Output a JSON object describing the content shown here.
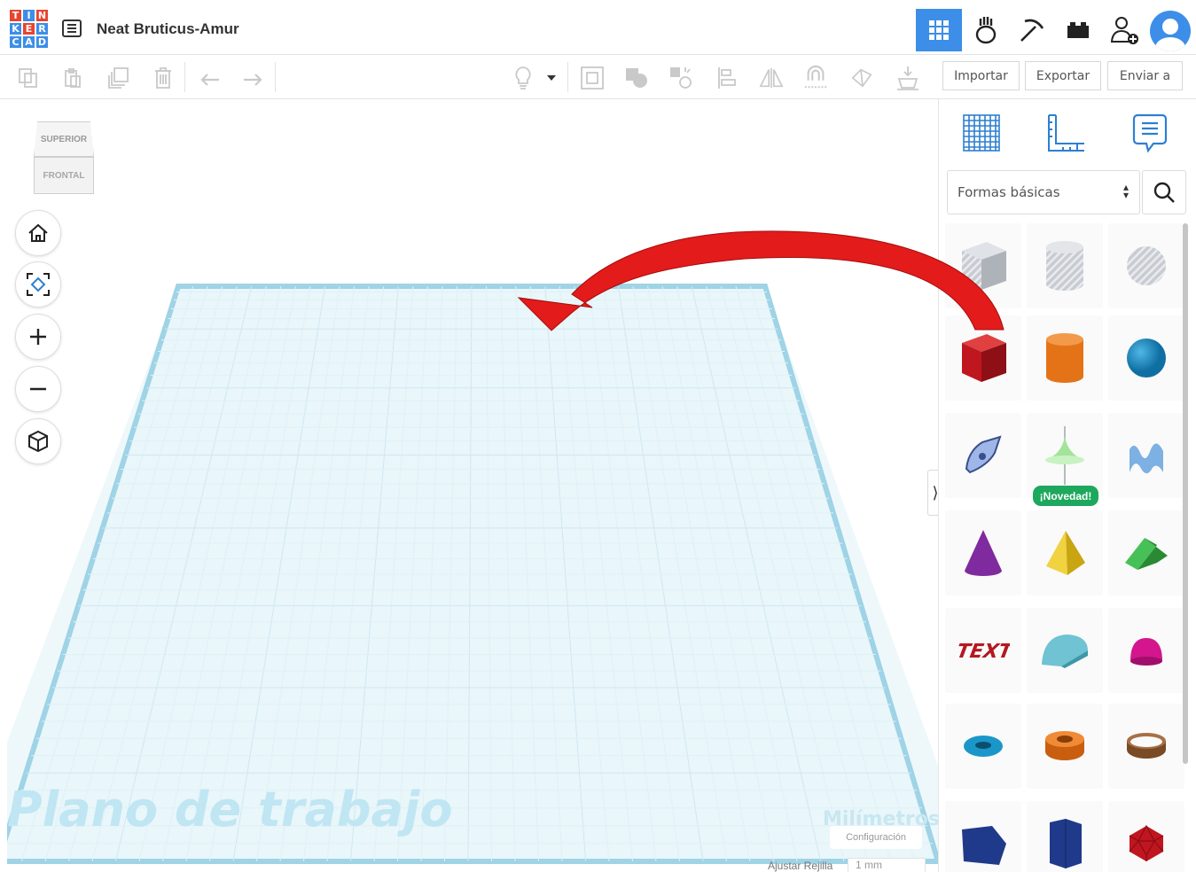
{
  "app": {
    "logo_letters": [
      "T",
      "I",
      "N",
      "K",
      "E",
      "R",
      "C",
      "A",
      "D"
    ],
    "logo_colors": [
      "#e8442e",
      "#3c8ee8",
      "#e8442e",
      "#3c8ee8",
      "#e8442e",
      "#3c8ee8",
      "#3c8ee8",
      "#3c8ee8",
      "#3c8ee8"
    ],
    "design_title": "Neat Bruticus-Amur",
    "accent_color": "#3c8ee8"
  },
  "top_nav": {
    "items": [
      {
        "icon": "grid-view-icon",
        "active": true
      },
      {
        "icon": "blocks-bot-icon",
        "active": false
      },
      {
        "icon": "pickaxe-icon",
        "active": false
      },
      {
        "icon": "brick-icon",
        "active": false
      },
      {
        "icon": "add-user-icon",
        "active": false
      },
      {
        "icon": "avatar-icon",
        "active": false
      }
    ]
  },
  "toolbar": {
    "tools": [
      "copy-icon",
      "paste-icon",
      "duplicate-icon",
      "delete-icon",
      "undo-icon",
      "redo-icon"
    ],
    "view_tools": [
      "light-bulb-icon",
      "dropdown-icon",
      "workplane-icon",
      "group-icon",
      "ungroup-icon",
      "align-icon",
      "mirror-icon",
      "magnet-icon",
      "solid-icon",
      "cruise-icon"
    ],
    "import_label": "Importar",
    "export_label": "Exportar",
    "send_label": "Enviar a"
  },
  "viewcube": {
    "top_label": "SUPERIOR",
    "front_label": "FRONTAL"
  },
  "nav_controls": [
    "home-icon",
    "fit-view-icon",
    "zoom-in-icon",
    "zoom-out-icon",
    "perspective-icon"
  ],
  "workplane": {
    "label": "Plano de trabajo",
    "units": "Milímetros",
    "settings_label": "Configuración",
    "snap_label": "Ajustar Rejilla",
    "snap_value": "1 mm"
  },
  "shapes_panel": {
    "category": "Formas básicas",
    "new_badge": "¡Novedad!",
    "shapes": [
      {
        "name": "hole-box",
        "color": "#b9bec6"
      },
      {
        "name": "hole-cylinder",
        "color": "#b9bec6"
      },
      {
        "name": "hole-sphere",
        "color": "#b9bec6"
      },
      {
        "name": "box",
        "color": "#c0161f"
      },
      {
        "name": "cylinder",
        "color": "#e47318"
      },
      {
        "name": "sphere",
        "color": "#1a8fc9"
      },
      {
        "name": "scribble",
        "color": "#7d9ad8"
      },
      {
        "name": "spinner",
        "color": "#a4e39a"
      },
      {
        "name": "wave",
        "color": "#7db0e3"
      },
      {
        "name": "cone",
        "color": "#7f2a9e"
      },
      {
        "name": "pyramid",
        "color": "#e8c71b"
      },
      {
        "name": "roof",
        "color": "#31a23c"
      },
      {
        "name": "text",
        "color": "#b41820"
      },
      {
        "name": "half-cylinder",
        "color": "#5fb7c7"
      },
      {
        "name": "paraboloid",
        "color": "#d3168d"
      },
      {
        "name": "torus",
        "color": "#1a97c8"
      },
      {
        "name": "tube",
        "color": "#e47318"
      },
      {
        "name": "ring",
        "color": "#8e5a32"
      },
      {
        "name": "wedge",
        "color": "#1f3a8a"
      },
      {
        "name": "polygon",
        "color": "#1f3a8a"
      },
      {
        "name": "icosahedron",
        "color": "#c0161f"
      }
    ]
  },
  "annotation": {
    "arrow_color": "#e31b1b"
  }
}
